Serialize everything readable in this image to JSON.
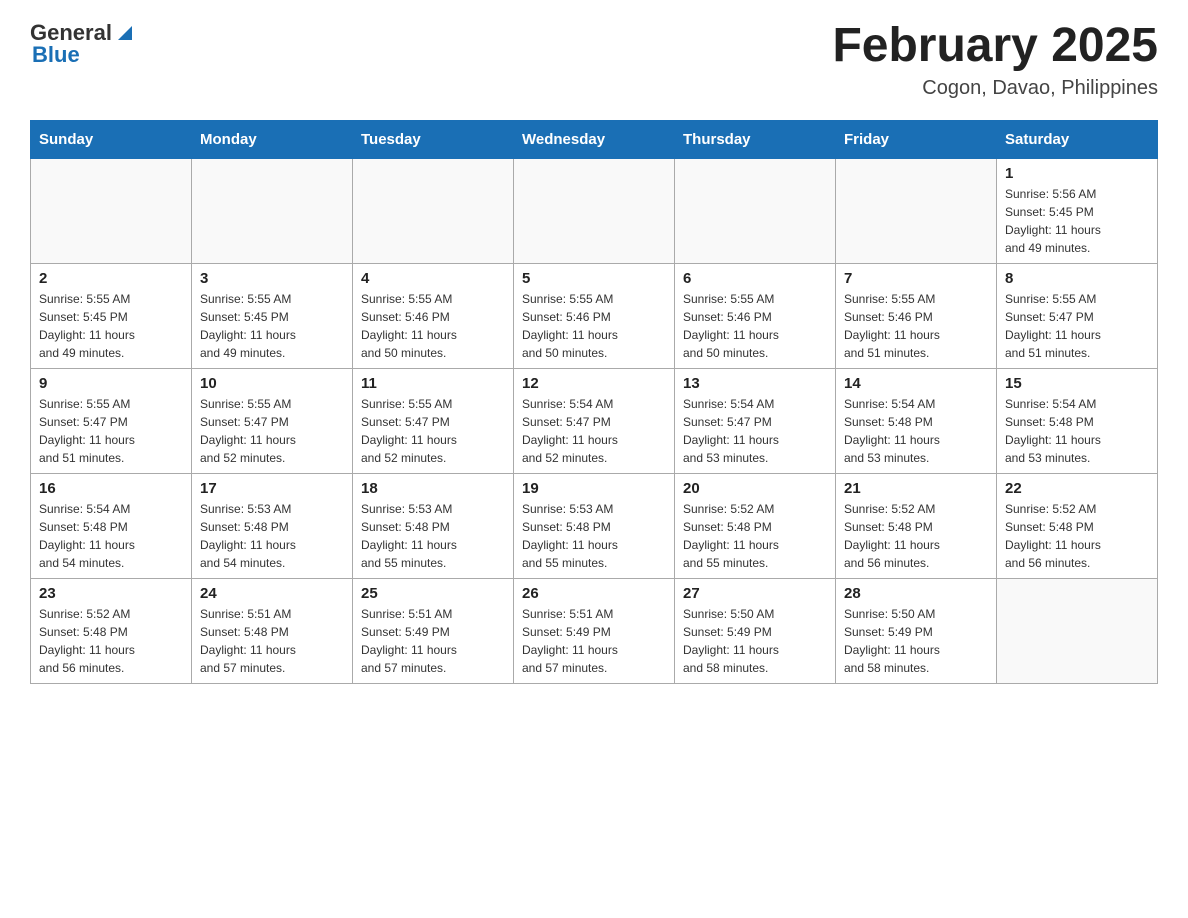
{
  "header": {
    "logo_general": "General",
    "logo_blue": "Blue",
    "month_title": "February 2025",
    "location": "Cogon, Davao, Philippines"
  },
  "days_of_week": [
    "Sunday",
    "Monday",
    "Tuesday",
    "Wednesday",
    "Thursday",
    "Friday",
    "Saturday"
  ],
  "weeks": [
    [
      {
        "day": "",
        "info": ""
      },
      {
        "day": "",
        "info": ""
      },
      {
        "day": "",
        "info": ""
      },
      {
        "day": "",
        "info": ""
      },
      {
        "day": "",
        "info": ""
      },
      {
        "day": "",
        "info": ""
      },
      {
        "day": "1",
        "info": "Sunrise: 5:56 AM\nSunset: 5:45 PM\nDaylight: 11 hours\nand 49 minutes."
      }
    ],
    [
      {
        "day": "2",
        "info": "Sunrise: 5:55 AM\nSunset: 5:45 PM\nDaylight: 11 hours\nand 49 minutes."
      },
      {
        "day": "3",
        "info": "Sunrise: 5:55 AM\nSunset: 5:45 PM\nDaylight: 11 hours\nand 49 minutes."
      },
      {
        "day": "4",
        "info": "Sunrise: 5:55 AM\nSunset: 5:46 PM\nDaylight: 11 hours\nand 50 minutes."
      },
      {
        "day": "5",
        "info": "Sunrise: 5:55 AM\nSunset: 5:46 PM\nDaylight: 11 hours\nand 50 minutes."
      },
      {
        "day": "6",
        "info": "Sunrise: 5:55 AM\nSunset: 5:46 PM\nDaylight: 11 hours\nand 50 minutes."
      },
      {
        "day": "7",
        "info": "Sunrise: 5:55 AM\nSunset: 5:46 PM\nDaylight: 11 hours\nand 51 minutes."
      },
      {
        "day": "8",
        "info": "Sunrise: 5:55 AM\nSunset: 5:47 PM\nDaylight: 11 hours\nand 51 minutes."
      }
    ],
    [
      {
        "day": "9",
        "info": "Sunrise: 5:55 AM\nSunset: 5:47 PM\nDaylight: 11 hours\nand 51 minutes."
      },
      {
        "day": "10",
        "info": "Sunrise: 5:55 AM\nSunset: 5:47 PM\nDaylight: 11 hours\nand 52 minutes."
      },
      {
        "day": "11",
        "info": "Sunrise: 5:55 AM\nSunset: 5:47 PM\nDaylight: 11 hours\nand 52 minutes."
      },
      {
        "day": "12",
        "info": "Sunrise: 5:54 AM\nSunset: 5:47 PM\nDaylight: 11 hours\nand 52 minutes."
      },
      {
        "day": "13",
        "info": "Sunrise: 5:54 AM\nSunset: 5:47 PM\nDaylight: 11 hours\nand 53 minutes."
      },
      {
        "day": "14",
        "info": "Sunrise: 5:54 AM\nSunset: 5:48 PM\nDaylight: 11 hours\nand 53 minutes."
      },
      {
        "day": "15",
        "info": "Sunrise: 5:54 AM\nSunset: 5:48 PM\nDaylight: 11 hours\nand 53 minutes."
      }
    ],
    [
      {
        "day": "16",
        "info": "Sunrise: 5:54 AM\nSunset: 5:48 PM\nDaylight: 11 hours\nand 54 minutes."
      },
      {
        "day": "17",
        "info": "Sunrise: 5:53 AM\nSunset: 5:48 PM\nDaylight: 11 hours\nand 54 minutes."
      },
      {
        "day": "18",
        "info": "Sunrise: 5:53 AM\nSunset: 5:48 PM\nDaylight: 11 hours\nand 55 minutes."
      },
      {
        "day": "19",
        "info": "Sunrise: 5:53 AM\nSunset: 5:48 PM\nDaylight: 11 hours\nand 55 minutes."
      },
      {
        "day": "20",
        "info": "Sunrise: 5:52 AM\nSunset: 5:48 PM\nDaylight: 11 hours\nand 55 minutes."
      },
      {
        "day": "21",
        "info": "Sunrise: 5:52 AM\nSunset: 5:48 PM\nDaylight: 11 hours\nand 56 minutes."
      },
      {
        "day": "22",
        "info": "Sunrise: 5:52 AM\nSunset: 5:48 PM\nDaylight: 11 hours\nand 56 minutes."
      }
    ],
    [
      {
        "day": "23",
        "info": "Sunrise: 5:52 AM\nSunset: 5:48 PM\nDaylight: 11 hours\nand 56 minutes."
      },
      {
        "day": "24",
        "info": "Sunrise: 5:51 AM\nSunset: 5:48 PM\nDaylight: 11 hours\nand 57 minutes."
      },
      {
        "day": "25",
        "info": "Sunrise: 5:51 AM\nSunset: 5:49 PM\nDaylight: 11 hours\nand 57 minutes."
      },
      {
        "day": "26",
        "info": "Sunrise: 5:51 AM\nSunset: 5:49 PM\nDaylight: 11 hours\nand 57 minutes."
      },
      {
        "day": "27",
        "info": "Sunrise: 5:50 AM\nSunset: 5:49 PM\nDaylight: 11 hours\nand 58 minutes."
      },
      {
        "day": "28",
        "info": "Sunrise: 5:50 AM\nSunset: 5:49 PM\nDaylight: 11 hours\nand 58 minutes."
      },
      {
        "day": "",
        "info": ""
      }
    ]
  ]
}
